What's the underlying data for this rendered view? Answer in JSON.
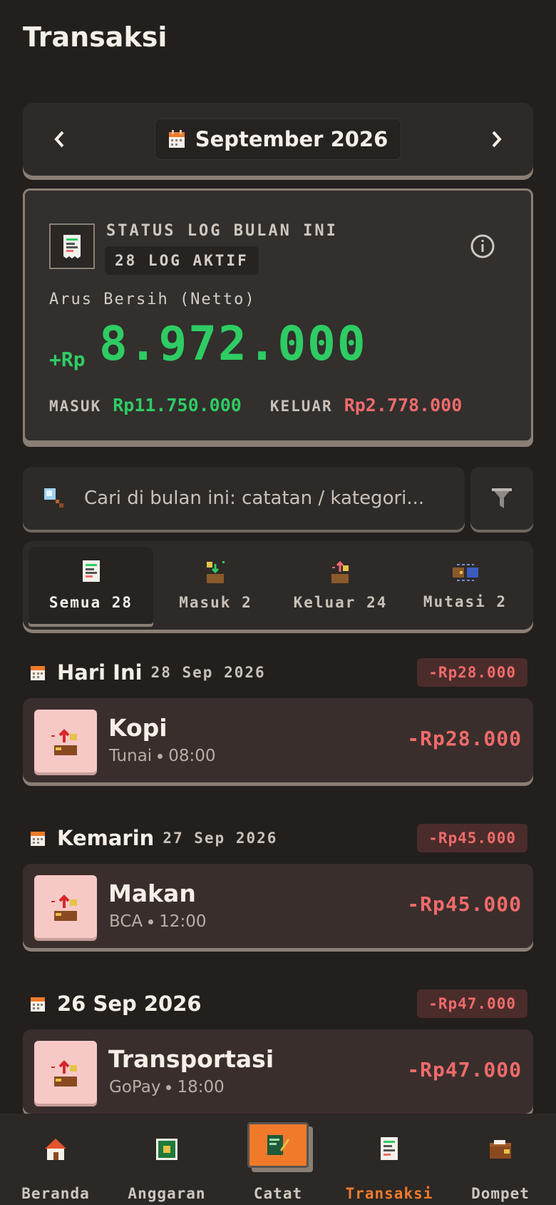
{
  "header": {
    "title": "Transaksi"
  },
  "month_selector": {
    "label": "September 2026"
  },
  "status": {
    "title": "STATUS LOG BULAN INI",
    "badge": "28 LOG AKTIF",
    "netto_label": "Arus Bersih (Netto)",
    "netto_prefix": "+Rp",
    "netto_value": "8.972.000",
    "in_label": "MASUK",
    "in_value": "Rp11.750.000",
    "out_label": "KELUAR",
    "out_value": "Rp2.778.000"
  },
  "search": {
    "placeholder": "Cari di bulan ini: catatan / kategori..."
  },
  "tabs": [
    {
      "label": "Semua 28",
      "icon": "receipt-icon",
      "active": true
    },
    {
      "label": "Masuk 2",
      "icon": "income-icon",
      "active": false
    },
    {
      "label": "Keluar 24",
      "icon": "expense-icon",
      "active": false
    },
    {
      "label": "Mutasi 2",
      "icon": "transfer-icon",
      "active": false
    }
  ],
  "groups": [
    {
      "title": "Hari Ini",
      "date": "28 Sep 2026",
      "total": "-Rp28.000",
      "items": [
        {
          "name": "Kopi",
          "wallet": "Tunai",
          "time": "08:00",
          "amount": "-Rp28.000"
        }
      ]
    },
    {
      "title": "Kemarin",
      "date": "27 Sep 2026",
      "total": "-Rp45.000",
      "items": [
        {
          "name": "Makan",
          "wallet": "BCA",
          "time": "12:00",
          "amount": "-Rp45.000"
        }
      ]
    },
    {
      "title": "26 Sep 2026",
      "date": "",
      "total": "-Rp47.000",
      "items": [
        {
          "name": "Transportasi",
          "wallet": "GoPay",
          "time": "18:00",
          "amount": "-Rp47.000"
        }
      ]
    }
  ],
  "bottom_nav": [
    {
      "label": "Beranda",
      "icon": "home-icon"
    },
    {
      "label": "Anggaran",
      "icon": "budget-icon"
    },
    {
      "label": "Catat",
      "icon": "note-icon"
    },
    {
      "label": "Transaksi",
      "icon": "receipt-icon",
      "active": true
    },
    {
      "label": "Dompet",
      "icon": "wallet-icon"
    }
  ],
  "colors": {
    "income": "#2ecc63",
    "expense": "#f06b6b",
    "accent": "#f07a2a",
    "background": "#221f1d"
  }
}
